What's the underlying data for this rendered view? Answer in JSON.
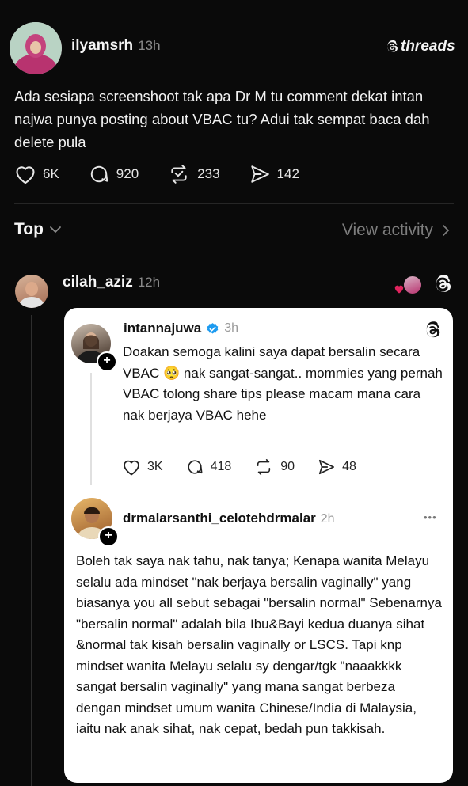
{
  "post": {
    "username": "ilyamsrh",
    "time": "13h",
    "brand": "threads",
    "text": "Ada sesiapa screenshoot tak apa Dr M tu comment dekat intan najwa punya posting about VBAC tu? Adui tak sempat baca dah delete pula",
    "likes": "6K",
    "replies": "920",
    "reposts": "233",
    "shares": "142"
  },
  "sort": {
    "label": "Top",
    "view_activity": "View activity"
  },
  "reply": {
    "username": "cilah_aziz",
    "time": "12h"
  },
  "quoted": {
    "post1": {
      "username": "intannajuwa",
      "time": "3h",
      "text": "Doakan semoga kalini saya dapat bersalin secara VBAC 🥺 nak sangat-sangat.. mommies yang pernah VBAC tolong share tips please macam mana cara nak berjaya VBAC hehe",
      "likes": "3K",
      "replies": "418",
      "reposts": "90",
      "shares": "48"
    },
    "post2": {
      "username": "drmalarsanthi_celotehdrmalar",
      "time": "2h",
      "more": "•••",
      "text": "Boleh tak saya nak tahu, nak tanya; Kenapa wanita Melayu selalu ada mindset \"nak berjaya bersalin vaginally\" yang biasanya you all sebut sebagai \"bersalin normal\" Sebenarnya \"bersalin normal\" adalah bila Ibu&Bayi kedua duanya sihat &normal tak kisah bersalin vaginally or LSCS. Tapi knp mindset wanita Melayu selalu sy dengar/tgk \"naaakkkk sangat bersalin vaginally\" yang mana sangat berbeza dengan mindset umum wanita Chinese/India di Malaysia, iaitu nak anak sihat, nak cepat, bedah pun takkisah."
    }
  },
  "colors": {
    "background": "#0a0a0a",
    "verified": "#1d9bf0",
    "like_red": "#e0245e"
  }
}
